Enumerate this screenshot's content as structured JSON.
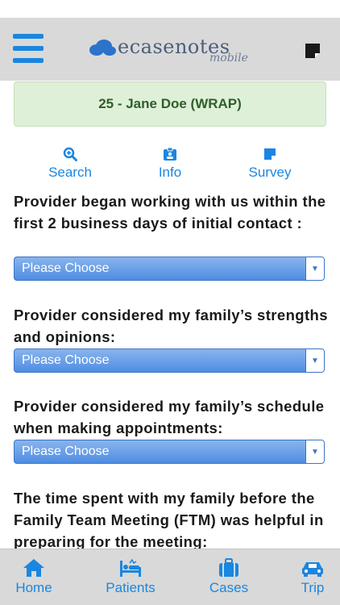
{
  "header": {
    "logo_text": "ecasenotes",
    "logo_subtext": "mobile",
    "icons": {
      "menu": "hamburger-menu-icon",
      "note": "sticky-note-icon"
    }
  },
  "banner": {
    "text": "25 - Jane Doe (WRAP)"
  },
  "actions": [
    {
      "label": "Search",
      "icon": "zoom-in-icon"
    },
    {
      "label": "Info",
      "icon": "id-badge-icon"
    },
    {
      "label": "Survey",
      "icon": "sticky-note-icon"
    }
  ],
  "questions": [
    {
      "text": "Provider began working with us within the first 2 business days of initial contact :",
      "selected": "Please Choose"
    },
    {
      "text": "Provider considered my family’s strengths and opinions:",
      "selected": "Please Choose"
    },
    {
      "text": "Provider considered my family’s schedule when making appointments:",
      "selected": "Please Choose"
    },
    {
      "text": "The time spent with my family before the Family Team Meeting (FTM) was helpful in preparing for the meeting:"
    }
  ],
  "tabbar": [
    {
      "label": "Home",
      "icon": "home-icon"
    },
    {
      "label": "Patients",
      "icon": "hospital-bed-icon"
    },
    {
      "label": "Cases",
      "icon": "briefcase-icon"
    },
    {
      "label": "Trip",
      "icon": "car-icon"
    }
  ],
  "colors": {
    "accent": "#1a86e0",
    "banner_bg": "#dff0d8",
    "banner_text": "#2f5e2b",
    "header_bg": "#d9d9d9",
    "select_blue": "#4f8de2"
  }
}
